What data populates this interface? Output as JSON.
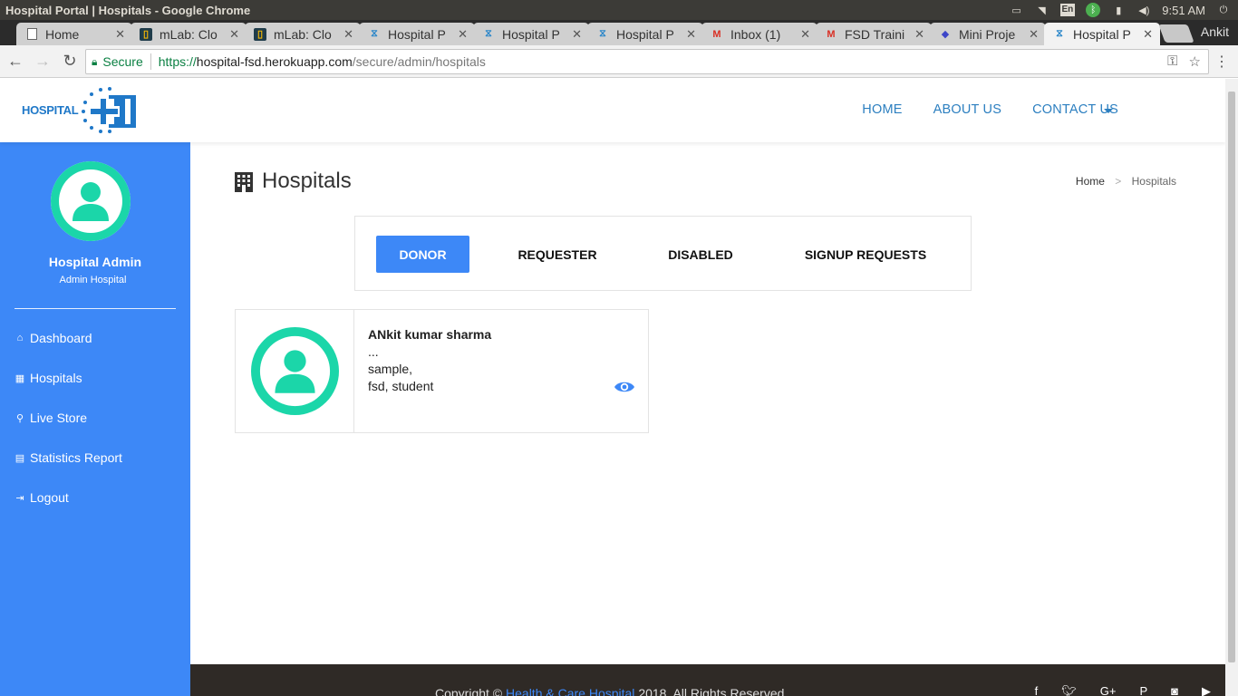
{
  "os": {
    "window_title": "Hospital Portal | Hospitals - Google Chrome",
    "tray": {
      "lang": "En",
      "time": "9:51 AM"
    }
  },
  "browser": {
    "tabs": [
      {
        "title": "Home",
        "icon": "doc-icon"
      },
      {
        "title": "mLab: Clo",
        "icon": "mlab-icon"
      },
      {
        "title": "mLab: Clo",
        "icon": "mlab-icon"
      },
      {
        "title": "Hospital P",
        "icon": "hospital-icon"
      },
      {
        "title": "Hospital P",
        "icon": "hospital-icon"
      },
      {
        "title": "Hospital P",
        "icon": "hospital-icon"
      },
      {
        "title": "Inbox (1)",
        "icon": "gmail-icon"
      },
      {
        "title": "FSD Traini",
        "icon": "gmail-icon"
      },
      {
        "title": "Mini Proje",
        "icon": "dropbox-icon"
      },
      {
        "title": "Hospital P",
        "icon": "hospital-icon",
        "active": true
      }
    ],
    "profile": "Ankit",
    "secure_label": "Secure",
    "url": {
      "scheme": "https://",
      "host": "hospital-fsd.herokuapp.com",
      "path": "/secure/admin/hospitals"
    }
  },
  "site": {
    "logo_text": "HOSPITAL",
    "nav": [
      "HOME",
      "ABOUT US",
      "CONTACT US"
    ]
  },
  "sidebar": {
    "name": "Hospital Admin",
    "role": "Admin Hospital",
    "items": [
      {
        "label": "Dashboard",
        "icon": "home-icon"
      },
      {
        "label": "Hospitals",
        "icon": "building-icon"
      },
      {
        "label": "Live Store",
        "icon": "search-icon"
      },
      {
        "label": "Statistics Report",
        "icon": "list-icon"
      },
      {
        "label": "Logout",
        "icon": "logout-icon"
      }
    ]
  },
  "main": {
    "title": "Hospitals",
    "breadcrumb": {
      "home": "Home",
      "sep": ">",
      "current": "Hospitals"
    },
    "tabs": [
      "DONOR",
      "REQUESTER",
      "DISABLED",
      "SIGNUP REQUESTS"
    ],
    "active_tab": "DONOR",
    "cards": [
      {
        "name": "ANkit kumar sharma",
        "line1": "...",
        "line2": "sample,",
        "line3": "fsd, student"
      }
    ]
  },
  "footer": {
    "prefix": "Copyright ©",
    "link": "Health & Care Hospital",
    "suffix": "2018. All Rights Reserved."
  },
  "colors": {
    "sidebar": "#3d88f7",
    "accent": "#3d88f7",
    "avatar": "#1bd6a9",
    "nav_link": "#2c7fc0",
    "footer": "#2f2a26"
  }
}
